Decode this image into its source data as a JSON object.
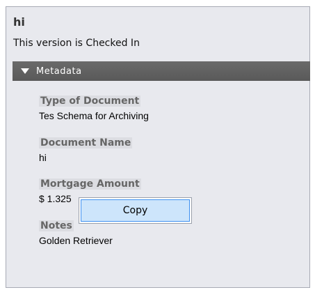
{
  "document": {
    "title": "hi",
    "status": "This version is Checked In"
  },
  "metadata_section": {
    "header": "Metadata",
    "expanded": true,
    "fields": [
      {
        "label": "Type of Document",
        "value": "Tes Schema for Archiving"
      },
      {
        "label": "Document Name",
        "value": "hi"
      },
      {
        "label": "Mortgage Amount",
        "value": "$ 1.325"
      },
      {
        "label": "Notes",
        "value": "Golden Retriever"
      }
    ]
  },
  "context_menu": {
    "items": [
      "Copy"
    ]
  }
}
